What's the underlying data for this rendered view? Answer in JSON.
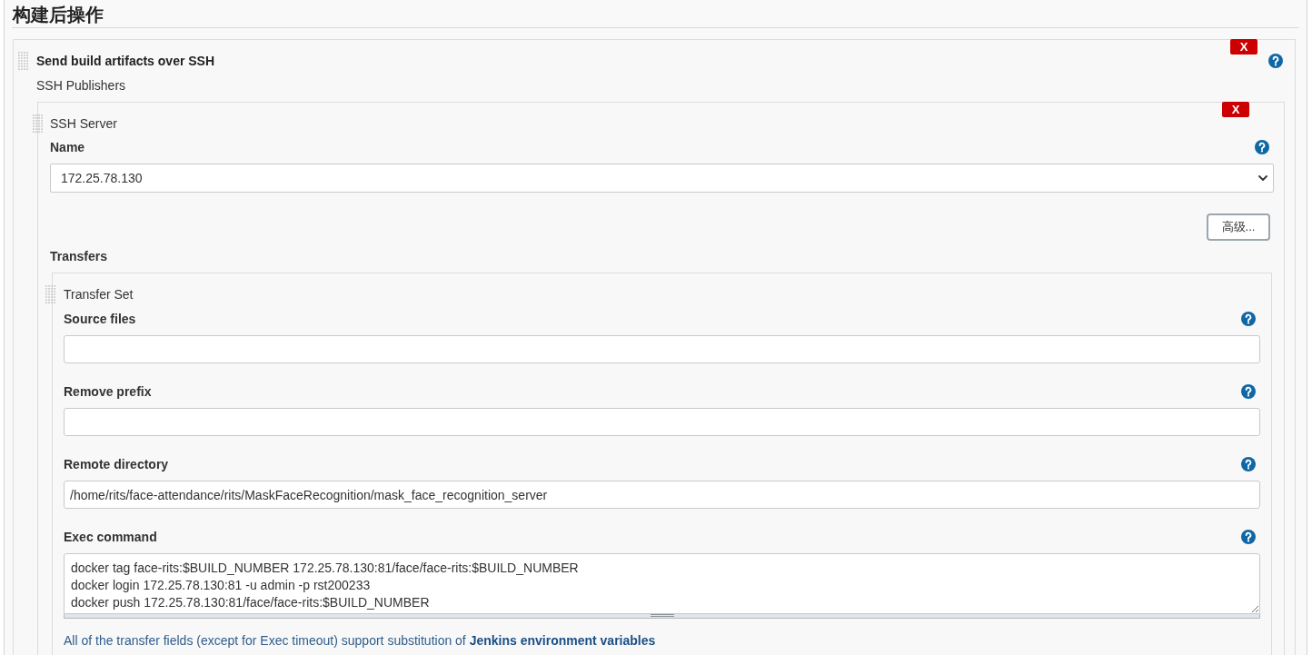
{
  "section": {
    "title": "构建后操作"
  },
  "publisher": {
    "title": "Send build artifacts over SSH",
    "delete_button": "X",
    "subtitle": "SSH Publishers",
    "server": {
      "title": "SSH Server",
      "delete_button": "X",
      "name_field": {
        "label": "Name",
        "value": "172.25.78.130"
      },
      "advanced_button": "高级...",
      "transfers_label": "Transfers",
      "transfer_set": {
        "title": "Transfer Set",
        "fields": [
          {
            "kind": "input",
            "label": "Source files"
          },
          {
            "kind": "input",
            "label": "Remove prefix"
          },
          {
            "kind": "input",
            "label": "Remote directory",
            "value": "/home/rits/face-attendance/rits/MaskFaceRecognition/mask_face_recognition_server"
          },
          {
            "kind": "textarea",
            "label": "Exec command",
            "value": "docker tag face-rits:$BUILD_NUMBER 172.25.78.130:81/face/face-rits:$BUILD_NUMBER\ndocker login 172.25.78.130:81 -u admin -p rst200233\ndocker push 172.25.78.130:81/face/face-rits:$BUILD_NUMBER"
          }
        ],
        "note": {
          "text": "All of the transfer fields (except for Exec timeout) support substitution of",
          "link": "Jenkins environment variables"
        }
      }
    }
  }
}
